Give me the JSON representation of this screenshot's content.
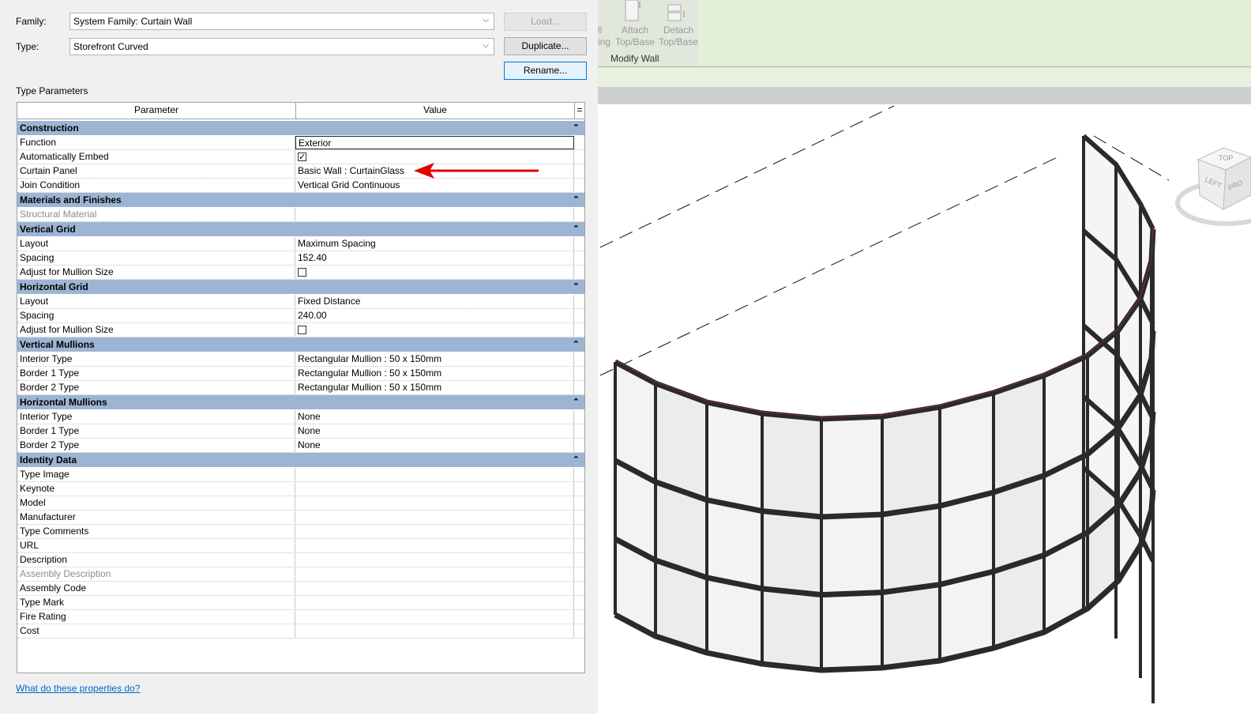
{
  "dialog": {
    "family_label": "Family:",
    "family_value": "System Family: Curtain Wall",
    "type_label": "Type:",
    "type_value": "Storefront Curved",
    "load_button": "Load...",
    "duplicate_button": "Duplicate...",
    "rename_button": "Rename...",
    "type_parameters_label": "Type Parameters",
    "col_parameter": "Parameter",
    "col_value": "Value",
    "collapse_glyph": "⌃",
    "help_link": "What do these properties do?"
  },
  "groups": [
    {
      "name": "Construction",
      "rows": [
        {
          "param": "Function",
          "value": "Exterior",
          "kind": "edit"
        },
        {
          "param": "Automatically Embed",
          "value": "",
          "kind": "check-on"
        },
        {
          "param": "Curtain Panel",
          "value": "Basic Wall : CurtainGlass",
          "kind": "text"
        },
        {
          "param": "Join Condition",
          "value": "Vertical Grid Continuous",
          "kind": "text"
        }
      ]
    },
    {
      "name": "Materials and Finishes",
      "rows": [
        {
          "param": "Structural Material",
          "value": "",
          "kind": "gray"
        }
      ]
    },
    {
      "name": "Vertical Grid",
      "rows": [
        {
          "param": "Layout",
          "value": "Maximum Spacing",
          "kind": "text"
        },
        {
          "param": "Spacing",
          "value": "152.40",
          "kind": "text"
        },
        {
          "param": "Adjust for Mullion Size",
          "value": "",
          "kind": "check-off"
        }
      ]
    },
    {
      "name": "Horizontal Grid",
      "rows": [
        {
          "param": "Layout",
          "value": "Fixed Distance",
          "kind": "text"
        },
        {
          "param": "Spacing",
          "value": "240.00",
          "kind": "text"
        },
        {
          "param": "Adjust for Mullion Size",
          "value": "",
          "kind": "check-off"
        }
      ]
    },
    {
      "name": "Vertical Mullions",
      "rows": [
        {
          "param": "Interior Type",
          "value": "Rectangular Mullion : 50 x 150mm",
          "kind": "text"
        },
        {
          "param": "Border 1 Type",
          "value": "Rectangular Mullion : 50 x 150mm",
          "kind": "text"
        },
        {
          "param": "Border 2 Type",
          "value": "Rectangular Mullion : 50 x 150mm",
          "kind": "text"
        }
      ]
    },
    {
      "name": "Horizontal Mullions",
      "rows": [
        {
          "param": "Interior Type",
          "value": "None",
          "kind": "text"
        },
        {
          "param": "Border 1 Type",
          "value": "None",
          "kind": "text"
        },
        {
          "param": "Border 2 Type",
          "value": "None",
          "kind": "text"
        }
      ]
    },
    {
      "name": "Identity Data",
      "rows": [
        {
          "param": "Type Image",
          "value": "",
          "kind": "text"
        },
        {
          "param": "Keynote",
          "value": "",
          "kind": "text"
        },
        {
          "param": "Model",
          "value": "",
          "kind": "text"
        },
        {
          "param": "Manufacturer",
          "value": "",
          "kind": "text"
        },
        {
          "param": "Type Comments",
          "value": "",
          "kind": "text"
        },
        {
          "param": "URL",
          "value": "",
          "kind": "text"
        },
        {
          "param": "Description",
          "value": "",
          "kind": "text"
        },
        {
          "param": "Assembly Description",
          "value": "",
          "kind": "gray"
        },
        {
          "param": "Assembly Code",
          "value": "",
          "kind": "text"
        },
        {
          "param": "Type Mark",
          "value": "",
          "kind": "text"
        },
        {
          "param": "Fire Rating",
          "value": "",
          "kind": "text"
        },
        {
          "param": "Cost",
          "value": "",
          "kind": "text"
        }
      ]
    }
  ],
  "ribbon": {
    "tool1_line1": "ll",
    "tool1_line2": "ing",
    "attach_line1": "Attach",
    "attach_line2": "Top/Base",
    "detach_line1": "Detach",
    "detach_line2": "Top/Base",
    "panel_title": "Modify Wall"
  },
  "viewcube": {
    "top": "TOP",
    "left": "LEFT",
    "front": "FRO"
  },
  "colors": {
    "group_header": "#9db5d4",
    "ribbon": "#e4efd8",
    "arrow": "#e00000"
  }
}
